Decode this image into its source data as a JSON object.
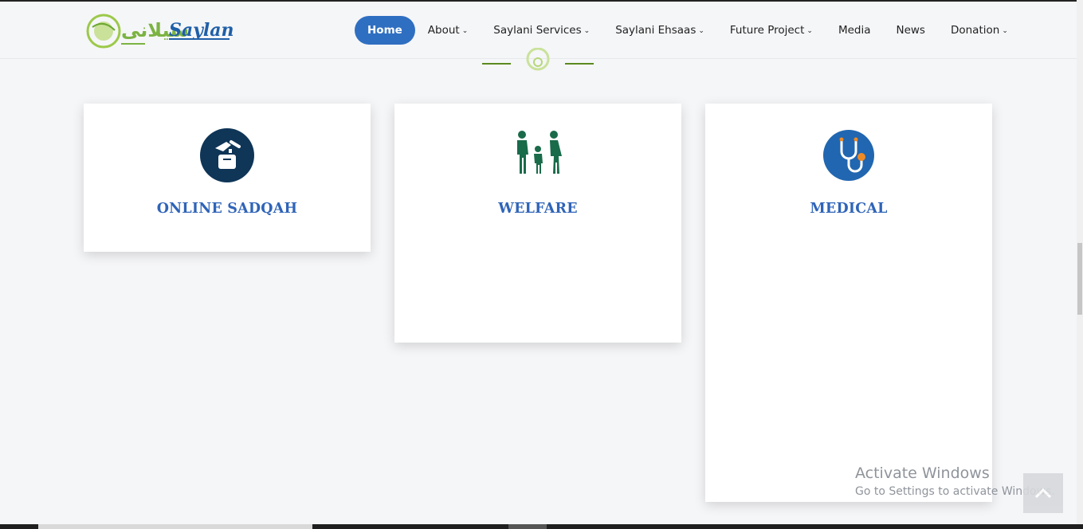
{
  "brand": {
    "logo_text": "Saylani",
    "logo_urdu": "سیلانی",
    "accent": "#2f6fc1",
    "green": "#7cb342"
  },
  "nav": {
    "items": [
      {
        "label": "Home",
        "active": true,
        "dropdown": false
      },
      {
        "label": "About",
        "dropdown": true
      },
      {
        "label": "Saylani Services",
        "dropdown": true
      },
      {
        "label": "Saylani Ehsaas",
        "dropdown": true
      },
      {
        "label": "Future Project",
        "dropdown": true
      },
      {
        "label": "Media",
        "dropdown": false
      },
      {
        "label": "News",
        "dropdown": false
      },
      {
        "label": "Donation",
        "dropdown": true
      }
    ],
    "caret": "⌄"
  },
  "cards": [
    {
      "title": "ONLINE SADQAH",
      "icon": "donation-box-icon"
    },
    {
      "title": "WELFARE",
      "icon": "family-icon"
    },
    {
      "title": "MEDICAL",
      "icon": "stethoscope-icon"
    }
  ],
  "watermark": {
    "line1": "Activate Windows",
    "line2": "Go to Settings to activate Windows."
  }
}
